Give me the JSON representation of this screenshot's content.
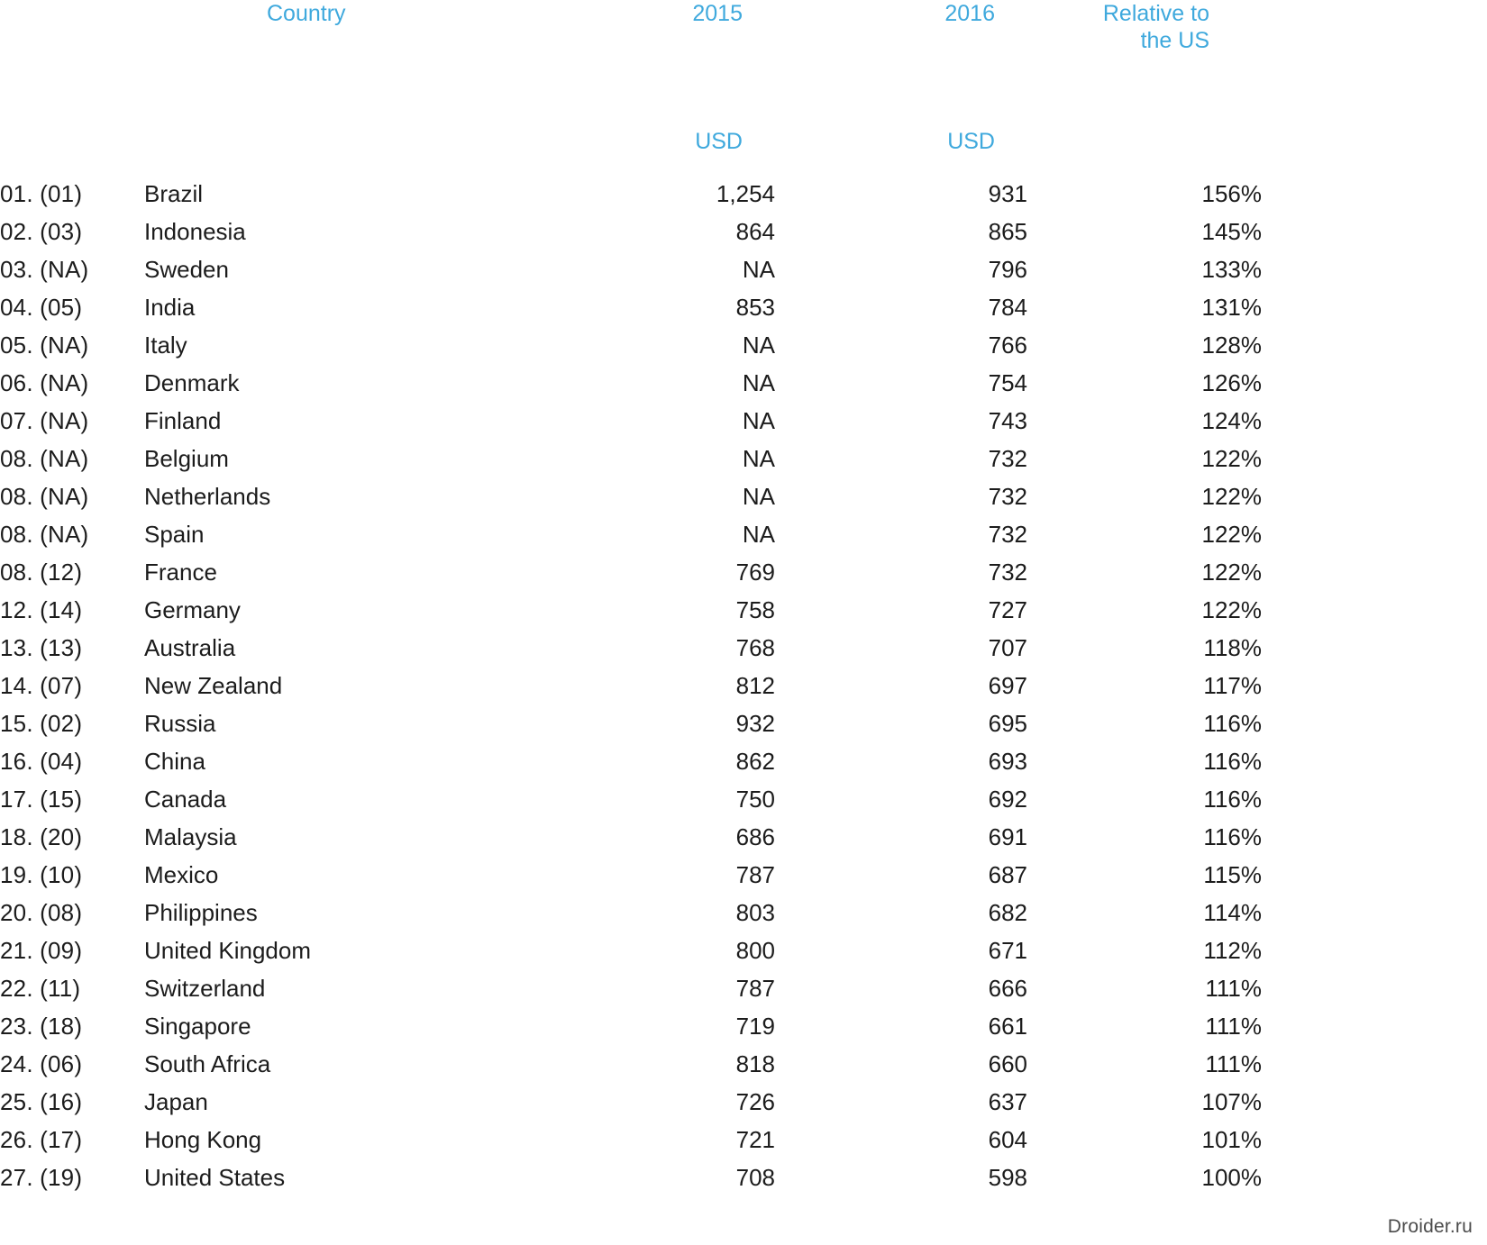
{
  "table": {
    "headers": {
      "rank": "",
      "country": "Country",
      "year2015": "2015",
      "year2016": "2016",
      "relative": "Relative to\nthe US"
    },
    "units": {
      "year2015": "USD",
      "year2016": "USD"
    },
    "rows": [
      {
        "rank": "01. (01)",
        "country": "Brazil",
        "y2015": "1,254",
        "y2016": "931",
        "relative": "156%"
      },
      {
        "rank": "02. (03)",
        "country": "Indonesia",
        "y2015": "864",
        "y2016": "865",
        "relative": "145%"
      },
      {
        "rank": "03. (NA)",
        "country": "Sweden",
        "y2015": "NA",
        "y2016": "796",
        "relative": "133%"
      },
      {
        "rank": "04. (05)",
        "country": "India",
        "y2015": "853",
        "y2016": "784",
        "relative": "131%"
      },
      {
        "rank": "05. (NA)",
        "country": "Italy",
        "y2015": "NA",
        "y2016": "766",
        "relative": "128%"
      },
      {
        "rank": "06. (NA)",
        "country": "Denmark",
        "y2015": "NA",
        "y2016": "754",
        "relative": "126%"
      },
      {
        "rank": "07. (NA)",
        "country": "Finland",
        "y2015": "NA",
        "y2016": "743",
        "relative": "124%"
      },
      {
        "rank": "08. (NA)",
        "country": "Belgium",
        "y2015": "NA",
        "y2016": "732",
        "relative": "122%"
      },
      {
        "rank": "08. (NA)",
        "country": "Netherlands",
        "y2015": "NA",
        "y2016": "732",
        "relative": "122%"
      },
      {
        "rank": "08. (NA)",
        "country": "Spain",
        "y2015": "NA",
        "y2016": "732",
        "relative": "122%"
      },
      {
        "rank": "08. (12)",
        "country": "France",
        "y2015": "769",
        "y2016": "732",
        "relative": "122%"
      },
      {
        "rank": "12. (14)",
        "country": "Germany",
        "y2015": "758",
        "y2016": "727",
        "relative": "122%"
      },
      {
        "rank": "13. (13)",
        "country": "Australia",
        "y2015": "768",
        "y2016": "707",
        "relative": "118%"
      },
      {
        "rank": "14. (07)",
        "country": "New Zealand",
        "y2015": "812",
        "y2016": "697",
        "relative": "117%"
      },
      {
        "rank": "15. (02)",
        "country": "Russia",
        "y2015": "932",
        "y2016": "695",
        "relative": "116%"
      },
      {
        "rank": "16. (04)",
        "country": "China",
        "y2015": "862",
        "y2016": "693",
        "relative": "116%"
      },
      {
        "rank": "17. (15)",
        "country": "Canada",
        "y2015": "750",
        "y2016": "692",
        "relative": "116%"
      },
      {
        "rank": "18. (20)",
        "country": "Malaysia",
        "y2015": "686",
        "y2016": "691",
        "relative": "116%"
      },
      {
        "rank": "19. (10)",
        "country": "Mexico",
        "y2015": "787",
        "y2016": "687",
        "relative": "115%"
      },
      {
        "rank": "20. (08)",
        "country": "Philippines",
        "y2015": "803",
        "y2016": "682",
        "relative": "114%"
      },
      {
        "rank": "21. (09)",
        "country": "United Kingdom",
        "y2015": "800",
        "y2016": "671",
        "relative": "112%"
      },
      {
        "rank": "22. (11)",
        "country": "Switzerland",
        "y2015": "787",
        "y2016": "666",
        "relative": "111%"
      },
      {
        "rank": "23. (18)",
        "country": "Singapore",
        "y2015": "719",
        "y2016": "661",
        "relative": "111%"
      },
      {
        "rank": "24. (06)",
        "country": "South Africa",
        "y2015": "818",
        "y2016": "660",
        "relative": "111%"
      },
      {
        "rank": "25. (16)",
        "country": "Japan",
        "y2015": "726",
        "y2016": "637",
        "relative": "107%"
      },
      {
        "rank": "26. (17)",
        "country": "Hong Kong",
        "y2015": "721",
        "y2016": "604",
        "relative": "101%"
      },
      {
        "rank": "27. (19)",
        "country": "United States",
        "y2015": "708",
        "y2016": "598",
        "relative": "100%"
      }
    ]
  },
  "watermark": "Droider.ru",
  "colors": {
    "header_accent": "#3fa9dd",
    "body_text": "#1c1c1c",
    "background": "#ffffff"
  }
}
